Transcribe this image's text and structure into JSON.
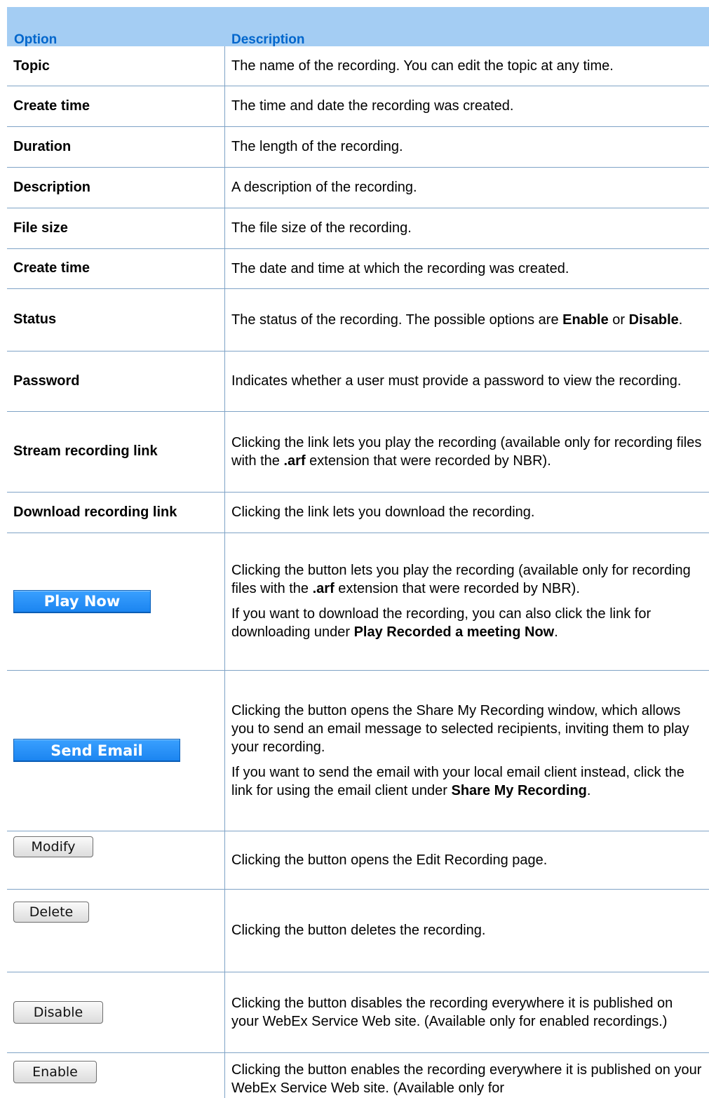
{
  "header": {
    "option": "Option",
    "description": "Description"
  },
  "rows": {
    "topic": {
      "label": "Topic",
      "desc": "The name of the recording. You can edit the topic at any time."
    },
    "create_time_1": {
      "label": "Create time",
      "desc": "The time and date the recording was created."
    },
    "duration": {
      "label": "Duration",
      "desc": "The length of the recording."
    },
    "description": {
      "label": "Description",
      "desc": "A description of the recording."
    },
    "file_size": {
      "label": "File size",
      "desc": "The file size of the recording."
    },
    "create_time_2": {
      "label": "Create time",
      "desc": "The date and time at which the recording was created."
    },
    "status": {
      "label": "Status",
      "desc_pre": "The status of the recording. The possible options are ",
      "desc_b1": "Enable",
      "desc_mid": " or ",
      "desc_b2": "Disable",
      "desc_end": "."
    },
    "password": {
      "label": "Password",
      "desc": "Indicates whether a user must provide a password to view the recording."
    },
    "stream": {
      "label": "Stream recording link",
      "desc_pre": "Clicking the link lets you play the recording (available only for recording files with the ",
      "desc_b": ".arf",
      "desc_end": " extension that were recorded by NBR)."
    },
    "download": {
      "label": "Download recording link",
      "desc": "Clicking the link lets you download the recording."
    },
    "play_now": {
      "button": "Play Now",
      "p1_pre": "Clicking the button lets you play the recording (available only for recording files with the ",
      "p1_b": ".arf",
      "p1_end": " extension that were recorded by NBR).",
      "p2_pre": "If you want to download the recording, you can also click the link for downloading under ",
      "p2_b": "Play Recorded a meeting Now",
      "p2_end": "."
    },
    "send_email": {
      "button": "Send Email",
      "p1": "Clicking the button opens the Share My Recording window, which allows you to send an email message to selected recipients, inviting them to play your recording.",
      "p2_pre": "If you want to send the email with your local email client instead, click the link for using the email client under ",
      "p2_b": "Share My Recording",
      "p2_end": "."
    },
    "modify": {
      "button": "Modify",
      "desc": "Clicking the button opens the Edit Recording page."
    },
    "delete": {
      "button": "Delete",
      "desc": "Clicking the button deletes the recording."
    },
    "disable": {
      "button": "Disable",
      "desc": "Clicking the button disables the recording everywhere it is published on your WebEx Service Web site. (Available only for enabled recordings.)"
    },
    "enable": {
      "button": "Enable",
      "desc": "Clicking the button enables the recording everywhere it is published on your WebEx Service Web site. (Available only for"
    }
  },
  "colors": {
    "header_bg": "#a4cdf3",
    "header_text": "#0066cc",
    "rule": "#7fa3c6",
    "blue_button": "#1a84f0"
  }
}
